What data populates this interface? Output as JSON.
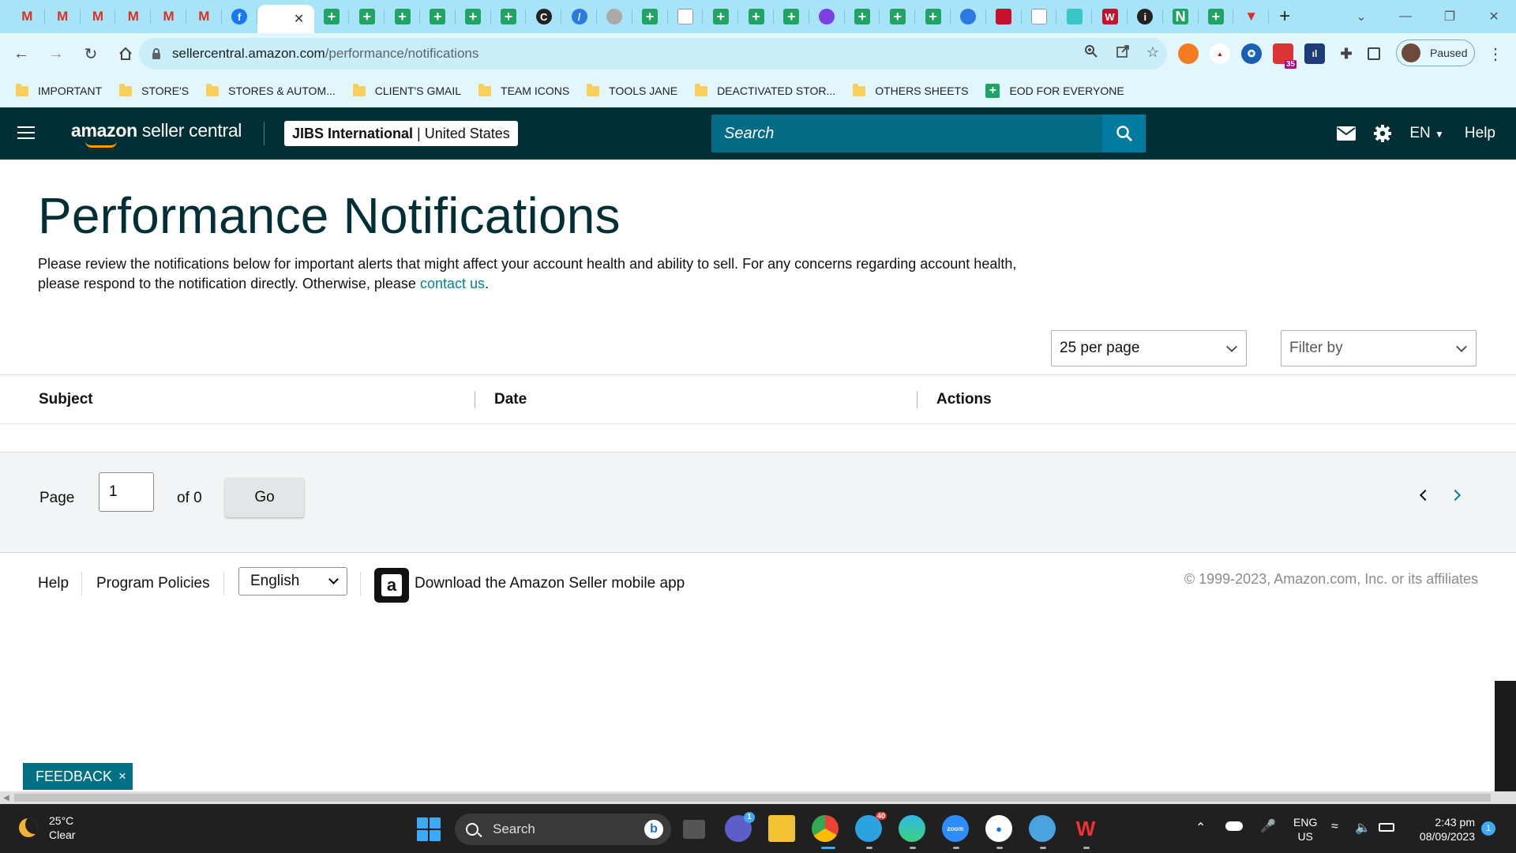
{
  "browser": {
    "tabs": [
      {
        "icon": "gmail-icon",
        "letter": "M",
        "kind": "gm"
      },
      {
        "icon": "gmail-icon",
        "letter": "M",
        "kind": "gm"
      },
      {
        "icon": "gmail-icon",
        "letter": "M",
        "kind": "gm"
      },
      {
        "icon": "gmail-icon",
        "letter": "M",
        "kind": "gm"
      },
      {
        "icon": "gmail-icon",
        "letter": "M",
        "kind": "gm"
      },
      {
        "icon": "gmail-icon",
        "letter": "M",
        "kind": "gm"
      },
      {
        "icon": "facebook-icon",
        "letter": "f",
        "kind": "fb"
      },
      {
        "icon": "amazon-icon",
        "letter": "",
        "kind": "active"
      },
      {
        "icon": "sheets-icon",
        "letter": "+",
        "kind": "sh"
      },
      {
        "icon": "sheets-icon",
        "letter": "+",
        "kind": "sh"
      },
      {
        "icon": "sheets-icon",
        "letter": "+",
        "kind": "sh"
      },
      {
        "icon": "sheets-icon",
        "letter": "+",
        "kind": "sh"
      },
      {
        "icon": "sheets-icon",
        "letter": "+",
        "kind": "sh"
      },
      {
        "icon": "sheets-icon",
        "letter": "+",
        "kind": "sh"
      },
      {
        "icon": "circle-c-icon",
        "letter": "C",
        "kind": "dk"
      },
      {
        "icon": "clickup-icon",
        "letter": "/",
        "kind": "bl"
      },
      {
        "icon": "grey-circle-icon",
        "letter": "",
        "kind": "gr"
      },
      {
        "icon": "sheets-icon",
        "letter": "+",
        "kind": "sh"
      },
      {
        "icon": "document-icon",
        "letter": "",
        "kind": "wt"
      },
      {
        "icon": "sheets-icon",
        "letter": "+",
        "kind": "sh"
      },
      {
        "icon": "sheets-icon",
        "letter": "+",
        "kind": "sh"
      },
      {
        "icon": "sheets-icon",
        "letter": "+",
        "kind": "sh"
      },
      {
        "icon": "messenger-icon",
        "letter": "",
        "kind": "pu"
      },
      {
        "icon": "sheets-icon",
        "letter": "+",
        "kind": "sh"
      },
      {
        "icon": "sheets-icon",
        "letter": "+",
        "kind": "sh"
      },
      {
        "icon": "sheets-icon",
        "letter": "+",
        "kind": "sh"
      },
      {
        "icon": "blue-circle-icon",
        "letter": "",
        "kind": "bl"
      },
      {
        "icon": "red-square-icon",
        "letter": "",
        "kind": "rd"
      },
      {
        "icon": "white-square-icon",
        "letter": "",
        "kind": "wt"
      },
      {
        "icon": "teal-icon",
        "letter": "",
        "kind": "tl"
      },
      {
        "icon": "w-icon",
        "letter": "W",
        "kind": "rd"
      },
      {
        "icon": "dark-circle-icon",
        "letter": "i",
        "kind": "dk"
      },
      {
        "icon": "n-icon",
        "letter": "N",
        "kind": "sh"
      },
      {
        "icon": "sheets-icon",
        "letter": "+",
        "kind": "sh"
      },
      {
        "icon": "red-triangle-icon",
        "letter": "▼",
        "kind": "gm"
      }
    ],
    "url_host": "sellercentral.amazon.com",
    "url_path": "/performance/notifications",
    "profile_status": "Paused",
    "ext_badge": "35"
  },
  "bookmarks": [
    {
      "label": "IMPORTANT",
      "type": "folder"
    },
    {
      "label": "STORE'S",
      "type": "folder"
    },
    {
      "label": "STORES & AUTOM...",
      "type": "folder"
    },
    {
      "label": "CLIENT'S GMAIL",
      "type": "folder"
    },
    {
      "label": "TEAM ICONS",
      "type": "folder"
    },
    {
      "label": "TOOLS JANE",
      "type": "folder"
    },
    {
      "label": "DEACTIVATED STOR...",
      "type": "folder"
    },
    {
      "label": "OTHERS SHEETS",
      "type": "folder"
    },
    {
      "label": "EOD FOR EVERYONE",
      "type": "sheet"
    }
  ],
  "header": {
    "logo_bold": "amazon",
    "logo_rest": " seller central",
    "store_name": "JIBS International",
    "store_sep": " | ",
    "store_region": "United States",
    "search_placeholder": "Search",
    "language": "EN",
    "help": "Help"
  },
  "page": {
    "title": "Performance Notifications",
    "intro_text": "Please review the notifications below for important alerts that might affect your account health and ability to sell. For any concerns regarding account health, please respond to the notification directly. Otherwise, please ",
    "intro_link": "contact us",
    "intro_end": ".",
    "per_page": "25 per page",
    "filter_placeholder": "Filter by",
    "columns": [
      "Subject",
      "Date",
      "Actions"
    ],
    "pager": {
      "page_label": "Page",
      "page_value": "1",
      "of_label": "of 0",
      "go_label": "Go"
    }
  },
  "footer": {
    "help": "Help",
    "policies": "Program Policies",
    "language": "English",
    "app_link": "Download the Amazon Seller mobile app",
    "copyright": "© 1999-2023, Amazon.com, Inc. or its affiliates"
  },
  "feedback": {
    "label": "FEEDBACK",
    "close": "×"
  },
  "taskbar": {
    "temperature": "25°C",
    "weather": "Clear",
    "search_label": "Search",
    "lang_top": "ENG",
    "lang_bottom": "US",
    "time": "2:43 pm",
    "date": "08/09/2023",
    "notifications": "1",
    "teams_badge": "1",
    "telegram_badge": "40"
  }
}
